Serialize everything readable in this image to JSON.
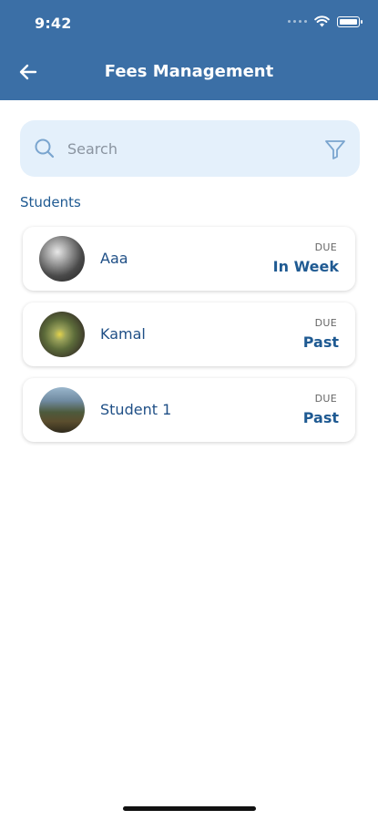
{
  "status_bar": {
    "time": "9:42"
  },
  "header": {
    "title": "Fees Management"
  },
  "search": {
    "placeholder": "Search"
  },
  "section": {
    "label": "Students"
  },
  "students": [
    {
      "name": "Aaa",
      "due_label": "DUE",
      "due_value": "In Week"
    },
    {
      "name": "Kamal",
      "due_label": "DUE",
      "due_value": "Past"
    },
    {
      "name": "Student 1",
      "due_label": "DUE",
      "due_value": "Past"
    }
  ],
  "colors": {
    "header": "#3b6fa6",
    "accent": "#1f5a92",
    "search_bg": "#e4f0fb"
  },
  "icons": [
    "back-arrow-icon",
    "search-icon",
    "filter-icon",
    "wifi-icon",
    "battery-icon"
  ]
}
